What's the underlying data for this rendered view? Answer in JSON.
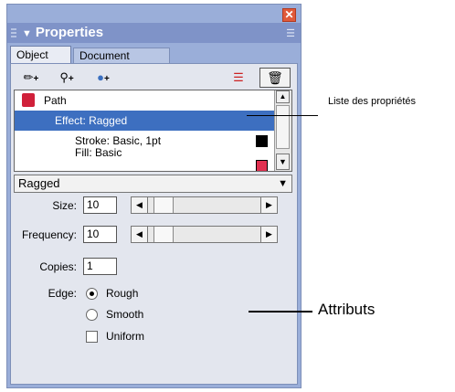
{
  "panel": {
    "title": "Properties",
    "title_arrow": "▼",
    "close_glyph": "✕",
    "tabs": [
      {
        "label": "Object"
      },
      {
        "label": "Document"
      }
    ],
    "toolbar": {
      "icons": [
        "pencil-add-icon",
        "brush-add-icon",
        "sphere-add-icon",
        "remove-attribute-icon",
        "trash-icon"
      ],
      "plus": "+"
    },
    "list": {
      "rows": [
        {
          "label": "Path"
        },
        {
          "label": "Effect: Ragged"
        },
        {
          "label": "Stroke: Basic, 1pt"
        },
        {
          "label": "Fill: Basic"
        }
      ]
    },
    "effect_dropdown": "Ragged",
    "attributes": {
      "size_label": "Size:",
      "size_value": "10",
      "frequency_label": "Frequency:",
      "frequency_value": "10",
      "copies_label": "Copies:",
      "copies_value": "1",
      "edge_label": "Edge:",
      "edge_options": [
        {
          "label": "Rough",
          "selected": true
        },
        {
          "label": "Smooth",
          "selected": false
        }
      ],
      "uniform_label": "Uniform",
      "uniform_checked": false
    }
  },
  "annotations": {
    "property_list": "Liste des propriétés",
    "attributes": "Attributs"
  }
}
